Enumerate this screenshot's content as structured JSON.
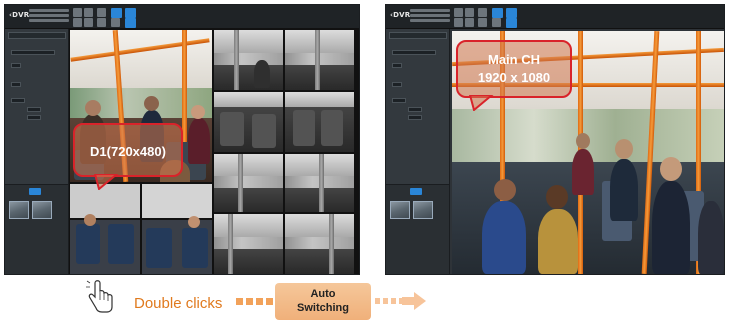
{
  "app": {
    "logo_text": "‹DVR"
  },
  "left_view": {
    "channel_label": "D1(720x480)"
  },
  "right_view": {
    "channel_line1": "Main CH",
    "channel_line2": "1920 x 1080"
  },
  "instruction": {
    "action_text": "Double clicks",
    "auto_line1": "Auto",
    "auto_line2": "Switching"
  },
  "colors": {
    "accent_blue": "#2a86d8",
    "callout_border": "#d9232a",
    "pole_orange": "#e8761c",
    "action_text": "#e07a1e",
    "badge_bg": "#f0b07a"
  },
  "icons": {
    "hand": "hand-pointer-icon",
    "arrow": "arrow-right-icon"
  }
}
